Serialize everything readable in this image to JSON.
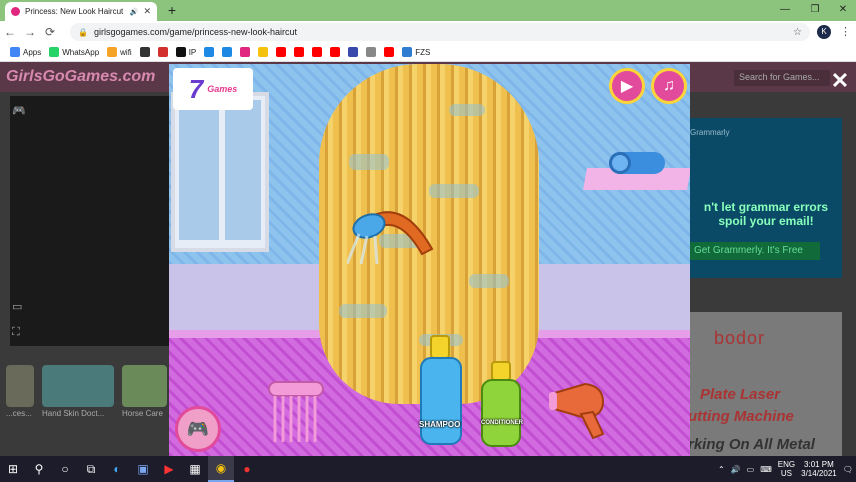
{
  "browser": {
    "tab_title": "Princess: New Look Haircut",
    "url": "girlsgogames.com/game/princess-new-look-haircut",
    "profile_initial": "K",
    "bookmarks": [
      {
        "label": "Apps",
        "color": "#4285f4",
        "icon": "apps-grid-icon"
      },
      {
        "label": "WhatsApp",
        "color": "#25d366",
        "icon": "whatsapp-icon"
      },
      {
        "label": "wifi",
        "color": "#f4a325",
        "icon": "wifi-icon"
      },
      {
        "label": "",
        "color": "#333333",
        "icon": "site-icon"
      },
      {
        "label": "",
        "color": "#d32f2f",
        "icon": "site-icon"
      },
      {
        "label": "IP",
        "color": "#111111",
        "icon": "ip-icon"
      },
      {
        "label": "",
        "color": "#1e88e5",
        "icon": "play-icon"
      },
      {
        "label": "",
        "color": "#1e88e5",
        "icon": "play-icon"
      },
      {
        "label": "",
        "color": "#e0267e",
        "icon": "site-icon"
      },
      {
        "label": "",
        "color": "#f4c20d",
        "icon": "site-icon"
      },
      {
        "label": "",
        "color": "#ff0000",
        "icon": "youtube-icon"
      },
      {
        "label": "",
        "color": "#ff0000",
        "icon": "youtube-icon"
      },
      {
        "label": "",
        "color": "#ff0000",
        "icon": "youtube-icon"
      },
      {
        "label": "",
        "color": "#ff0000",
        "icon": "youtube-icon"
      },
      {
        "label": "",
        "color": "#3949ab",
        "icon": "site-icon"
      },
      {
        "label": "",
        "color": "#888888",
        "icon": "site-icon"
      },
      {
        "label": "",
        "color": "#ff0000",
        "icon": "youtube-icon"
      },
      {
        "label": "FZS",
        "color": "#2e7dd1",
        "icon": "fzs-icon"
      }
    ]
  },
  "site": {
    "logo": "GirlsGoGames.com",
    "search_placeholder": "Search for Games...",
    "thumbnails": [
      {
        "label": "...ces..."
      },
      {
        "label": "Hand Skin Doct..."
      },
      {
        "label": "Horse Care"
      }
    ],
    "ad1": {
      "label": "Grammarly",
      "headline": "n't let grammar errors spoil your email!",
      "cta": "Get Grammerly. It's Free"
    },
    "ad2": {
      "brand": "bodor",
      "line1": "Plate Laser",
      "line2": "utting Machine",
      "line3": "rking On All Metal"
    }
  },
  "game": {
    "logo_text": "Games",
    "logo_number": "7",
    "shampoo_label": "SHAMPOO",
    "conditioner_label": "CONDITIONER"
  },
  "taskbar": {
    "lang_top": "ENG",
    "lang_bottom": "US",
    "time": "3:01 PM",
    "date": "3/14/2021"
  }
}
